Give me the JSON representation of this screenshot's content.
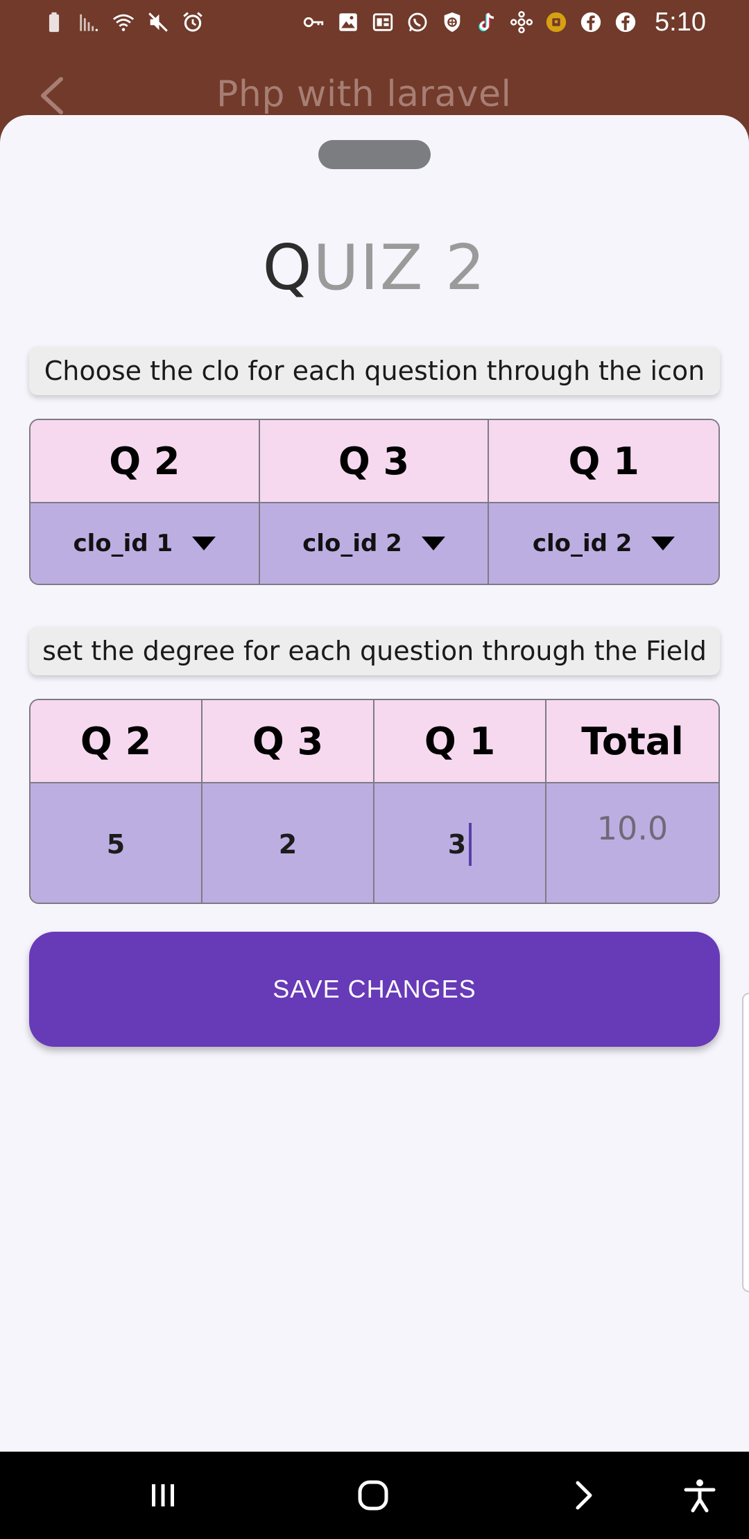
{
  "status_bar": {
    "time": "5:10",
    "left_icons": [
      "battery-icon",
      "signal-icon",
      "wifi-icon",
      "mute-icon",
      "alarm-icon"
    ],
    "right_icons": [
      "vpn-key-icon",
      "gallery-icon",
      "ms-icon",
      "whatsapp-icon",
      "vpn-shield-icon",
      "tiktok-icon",
      "network-icon",
      "coin-icon",
      "facebook-icon",
      "facebook-icon"
    ]
  },
  "app_bar": {
    "title": "Php with laravel"
  },
  "sheet": {
    "title_first": "Q",
    "title_rest": "UIZ 2",
    "clo_hint": "Choose the clo for each question through the icon",
    "degree_hint": "set the degree for each question through the Field",
    "clo_table": {
      "headers": [
        "Q 2",
        "Q 3",
        "Q 1"
      ],
      "selections": [
        "clo_id 1",
        "clo_id 2",
        "clo_id 2"
      ]
    },
    "degree_table": {
      "headers": [
        "Q 2",
        "Q 3",
        "Q 1",
        "Total"
      ],
      "values": [
        "5",
        "2",
        "3"
      ],
      "total": "10.0"
    },
    "save_label": "SAVE CHANGES"
  },
  "colors": {
    "app_bar": "#713a2a",
    "header_cell": "#f6d9ef",
    "body_cell": "#bdaee2",
    "primary": "#673ab7"
  }
}
